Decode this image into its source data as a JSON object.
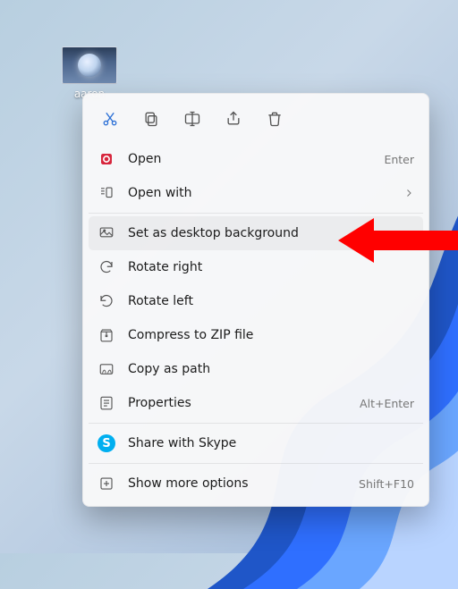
{
  "desktop": {
    "file_label": "aaron"
  },
  "action_row": {
    "items": [
      {
        "name": "cut-icon"
      },
      {
        "name": "copy-icon"
      },
      {
        "name": "rename-icon"
      },
      {
        "name": "share-icon"
      },
      {
        "name": "delete-icon"
      }
    ]
  },
  "menu": {
    "items": [
      {
        "name": "open",
        "label": "Open",
        "shortcut": "Enter"
      },
      {
        "name": "open-with",
        "label": "Open with",
        "submenu": true
      },
      {
        "name": "set-bg",
        "label": "Set as desktop background",
        "highlighted": true
      },
      {
        "name": "rotate-right",
        "label": "Rotate right"
      },
      {
        "name": "rotate-left",
        "label": "Rotate left"
      },
      {
        "name": "compress-zip",
        "label": "Compress to ZIP file"
      },
      {
        "name": "copy-path",
        "label": "Copy as path"
      },
      {
        "name": "properties",
        "label": "Properties",
        "shortcut": "Alt+Enter"
      },
      {
        "name": "share-skype",
        "label": "Share with Skype"
      },
      {
        "name": "more-options",
        "label": "Show more options",
        "shortcut": "Shift+F10"
      }
    ]
  }
}
